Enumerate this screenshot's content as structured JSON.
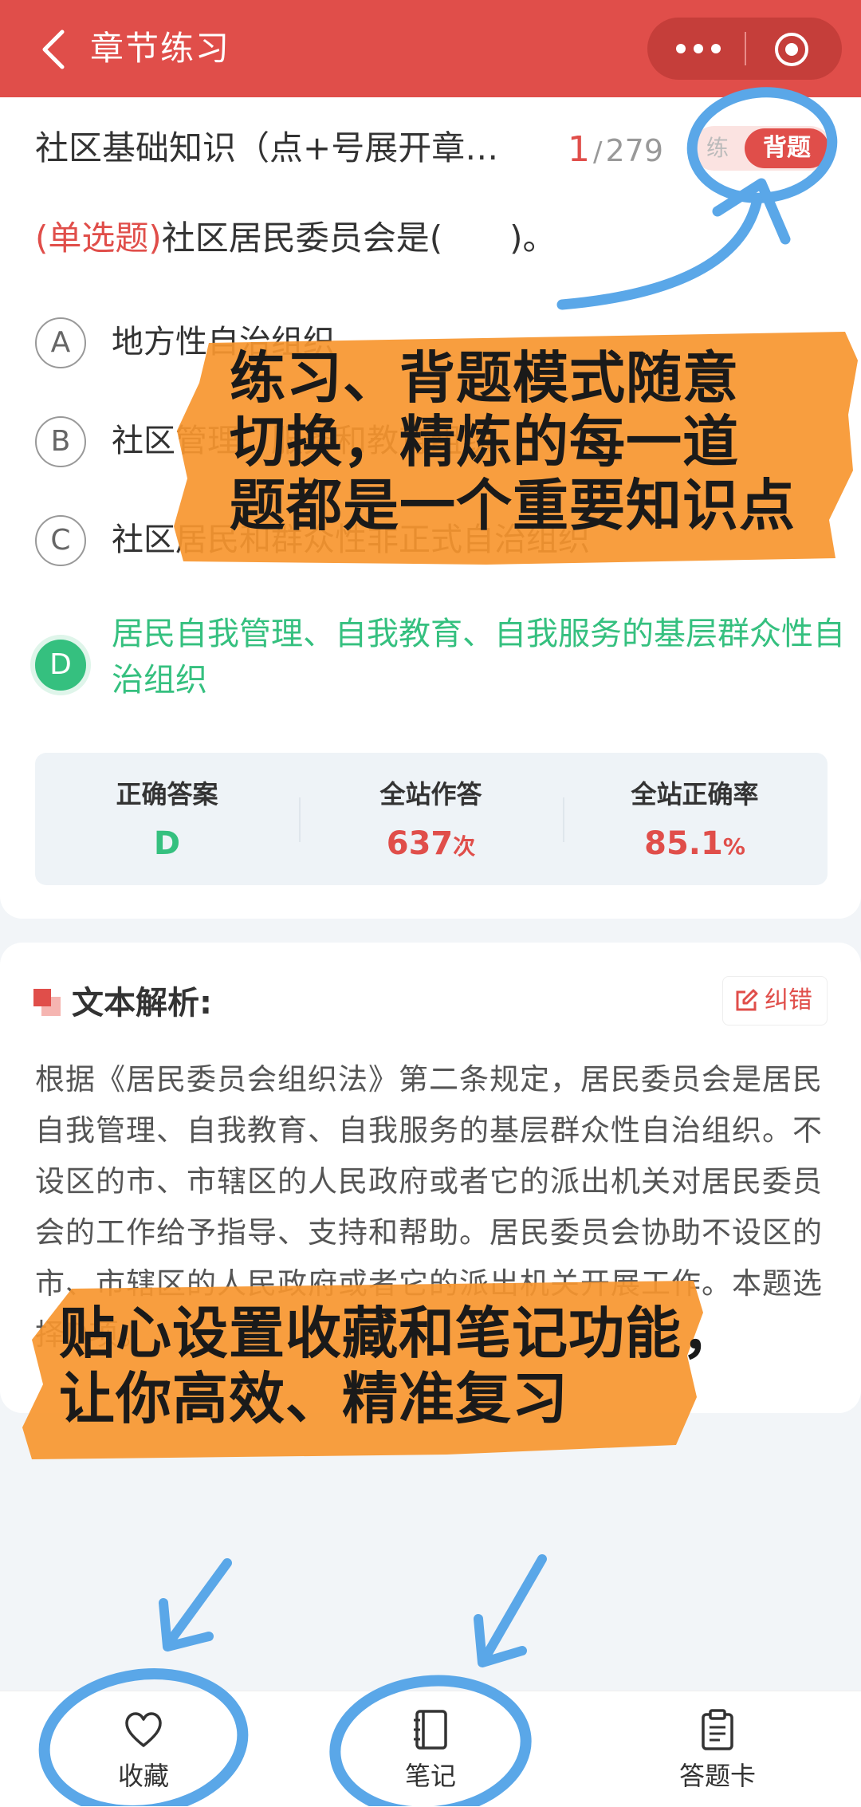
{
  "topbar": {
    "title": "章节练习",
    "back_icon": "chevron-left-icon",
    "more_icon": "more-dots-icon",
    "close_icon": "target-circle-icon",
    "bg_color": "#e04e4a"
  },
  "question_header": {
    "chapter_title": "社区基础知识（点+号展开章…",
    "progress": {
      "current": "1",
      "separator": "/",
      "total": "279"
    },
    "mode_toggle": {
      "practice_label": "练",
      "recite_label": "背题",
      "active": "背题"
    }
  },
  "question": {
    "type_label": "(单选题)",
    "stem": "社区居民委员会是(　　)。",
    "options": [
      {
        "letter": "A",
        "text": "地方性自治组织"
      },
      {
        "letter": "B",
        "text": "社区管理、服务和教育组织"
      },
      {
        "letter": "C",
        "text": "社区居民和群众性非正式自治组织"
      },
      {
        "letter": "D",
        "text": "居民自我管理、自我教育、自我服务的基层群众性自治组织",
        "correct": true
      }
    ]
  },
  "stats": {
    "correct_answer": {
      "label": "正确答案",
      "value": "D",
      "color": "#35c07f"
    },
    "total_answers": {
      "label": "全站作答",
      "value": "637",
      "unit": "次",
      "color": "#e04e4a"
    },
    "accuracy": {
      "label": "全站正确率",
      "value": "85.1",
      "unit": "%",
      "color": "#e04e4a"
    }
  },
  "analysis": {
    "title": "文本解析:",
    "report_label": "纠错",
    "report_icon": "edit-icon",
    "text": "根据《居民委员会组织法》第二条规定，居民委员会是居民自我管理、自我教育、自我服务的基层群众性自治组织。不设区的市、市辖区的人民政府或者它的派出机关对居民委员会的工作给予指导、支持和帮助。居民委员会协助不设区的市、市辖区的人民政府或者它的派出机关开展工作。本题选择D项。"
  },
  "bottom_bar": {
    "tabs": [
      {
        "label": "收藏",
        "icon": "heart-icon"
      },
      {
        "label": "笔记",
        "icon": "notebook-icon"
      },
      {
        "label": "答题卡",
        "icon": "clipboard-icon"
      }
    ]
  },
  "overlay": {
    "caption_top": [
      "练习、背题模式随意",
      "切换，精炼的每一道",
      "题都是一个重要知识点"
    ],
    "caption_bottom": [
      "贴心设置收藏和笔记功能，",
      "让你高效、精准复习"
    ],
    "highlight_color": "#f7962f",
    "circle_color": "#5aa7e8"
  }
}
